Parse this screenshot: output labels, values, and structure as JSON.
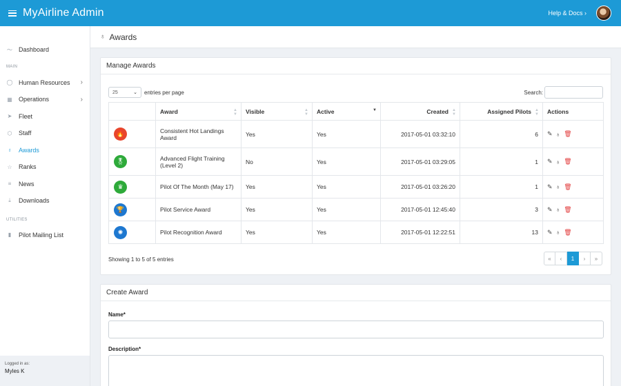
{
  "app": {
    "title": "MyAirline Admin",
    "help_label": "Help & Docs"
  },
  "icons": {
    "menu": "hamburger-icon",
    "help_chevron": "chevron-right-icon",
    "page": "award-ribbon-icon"
  },
  "sidebar": {
    "dashboard": "Dashboard",
    "section_main": "MAIN",
    "human_resources": "Human Resources",
    "operations": "Operations",
    "fleet": "Fleet",
    "staff": "Staff",
    "awards": "Awards",
    "ranks": "Ranks",
    "news": "News",
    "downloads": "Downloads",
    "section_utilities": "UTILITIES",
    "mailing_list": "Pilot Mailing List",
    "logged_in_label": "Logged in as:",
    "logged_in_user": "Myles K"
  },
  "page": {
    "title": "Awards"
  },
  "manage": {
    "title": "Manage Awards",
    "page_size": "25",
    "entries_label": "entries per page",
    "search_label": "Search:",
    "columns": {
      "award": "Award",
      "visible": "Visible",
      "active": "Active",
      "created": "Created",
      "pilots": "Assigned Pilots",
      "actions": "Actions"
    },
    "rows": [
      {
        "name": "Consistent Hot Landings Award",
        "visible": "Yes",
        "active": "Yes",
        "created": "2017-05-01 03:32:10",
        "pilots": "6",
        "badge_color": "#e8452c",
        "badge_glyph": "🔥"
      },
      {
        "name": "Advanced Flight Training (Level 2)",
        "visible": "No",
        "active": "Yes",
        "created": "2017-05-01 03:29:05",
        "pilots": "1",
        "badge_color": "#2eaa3a",
        "badge_glyph": "🎖"
      },
      {
        "name": "Pilot Of The Month (May 17)",
        "visible": "Yes",
        "active": "Yes",
        "created": "2017-05-01 03:26:20",
        "pilots": "1",
        "badge_color": "#2eaa3a",
        "badge_glyph": "♛"
      },
      {
        "name": "Pilot Service Award",
        "visible": "Yes",
        "active": "Yes",
        "created": "2017-05-01 12:45:40",
        "pilots": "3",
        "badge_color": "#1e78d0",
        "badge_glyph": "🏆"
      },
      {
        "name": "Pilot Recognition Award",
        "visible": "Yes",
        "active": "Yes",
        "created": "2017-05-01 12:22:51",
        "pilots": "13",
        "badge_color": "#1e78d0",
        "badge_glyph": "✺"
      }
    ],
    "showing": "Showing 1 to 5 of 5 entries",
    "pager": {
      "first": "«",
      "prev": "‹",
      "current": "1",
      "next": "›",
      "last": "»"
    }
  },
  "create": {
    "title": "Create Award",
    "name_label": "Name*",
    "description_label": "Description*"
  },
  "colors": {
    "accent": "#1d9ad6",
    "delete": "#e23b3b"
  }
}
